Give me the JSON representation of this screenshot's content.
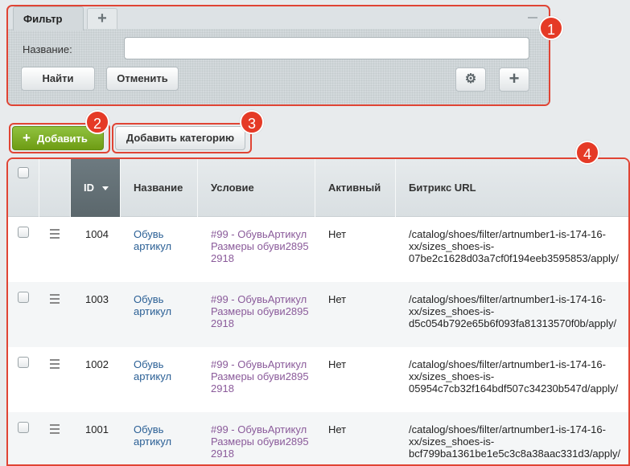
{
  "filter": {
    "tab_label": "Фильтр",
    "add_tab_icon": "+",
    "field_label": "Название:",
    "field_value": "",
    "find_label": "Найти",
    "cancel_label": "Отменить",
    "settings_icon": "⚙",
    "add_icon": "+"
  },
  "badges": [
    "1",
    "2",
    "3",
    "4"
  ],
  "actions": {
    "add_icon": "+",
    "add_label": "Добавить",
    "add_category_label": "Добавить категорию"
  },
  "table": {
    "columns": [
      "ID",
      "Название",
      "Условие",
      "Активный",
      "Битрикс URL"
    ],
    "rows": [
      {
        "id": "1004",
        "name_1": "Обувь",
        "name_2": "артикул",
        "cond_1": "#99 - ОбувьАртикул",
        "cond_2": "Размеры обуви2895",
        "cond_3": "2918",
        "active": "Нет",
        "url_1": "/catalog/shoes/filter/artnumber1-is-174-16-",
        "url_2": "xx/sizes_shoes-is-",
        "url_3": "07be2c1628d03a7cf0f194eeb3595853/apply/"
      },
      {
        "id": "1003",
        "name_1": "Обувь",
        "name_2": "артикул",
        "cond_1": "#99 - ОбувьАртикул",
        "cond_2": "Размеры обуви2895",
        "cond_3": "2918",
        "active": "Нет",
        "url_1": "/catalog/shoes/filter/artnumber1-is-174-16-",
        "url_2": "xx/sizes_shoes-is-",
        "url_3": "d5c054b792e65b6f093fa81313570f0b/apply/"
      },
      {
        "id": "1002",
        "name_1": "Обувь",
        "name_2": "артикул",
        "cond_1": "#99 - ОбувьАртикул",
        "cond_2": "Размеры обуви2895",
        "cond_3": "2918",
        "active": "Нет",
        "url_1": "/catalog/shoes/filter/artnumber1-is-174-16-",
        "url_2": "xx/sizes_shoes-is-",
        "url_3": "05954c7cb32f164bdf507c34230b547d/apply/"
      },
      {
        "id": "1001",
        "name_1": "Обувь",
        "name_2": "артикул",
        "cond_1": "#99 - ОбувьАртикул",
        "cond_2": "Размеры обуви2895",
        "cond_3": "2918",
        "active": "Нет",
        "url_1": "/catalog/shoes/filter/artnumber1-is-174-16-",
        "url_2": "xx/sizes_shoes-is-",
        "url_3": "bcf799ba1361be1e5c3c8a38aac331d3/apply/"
      }
    ]
  },
  "colors": {
    "highlight": "#e04434",
    "add_button": "#7eae22",
    "link": "#2a5f95",
    "condition_link": "#8a5a9a"
  }
}
